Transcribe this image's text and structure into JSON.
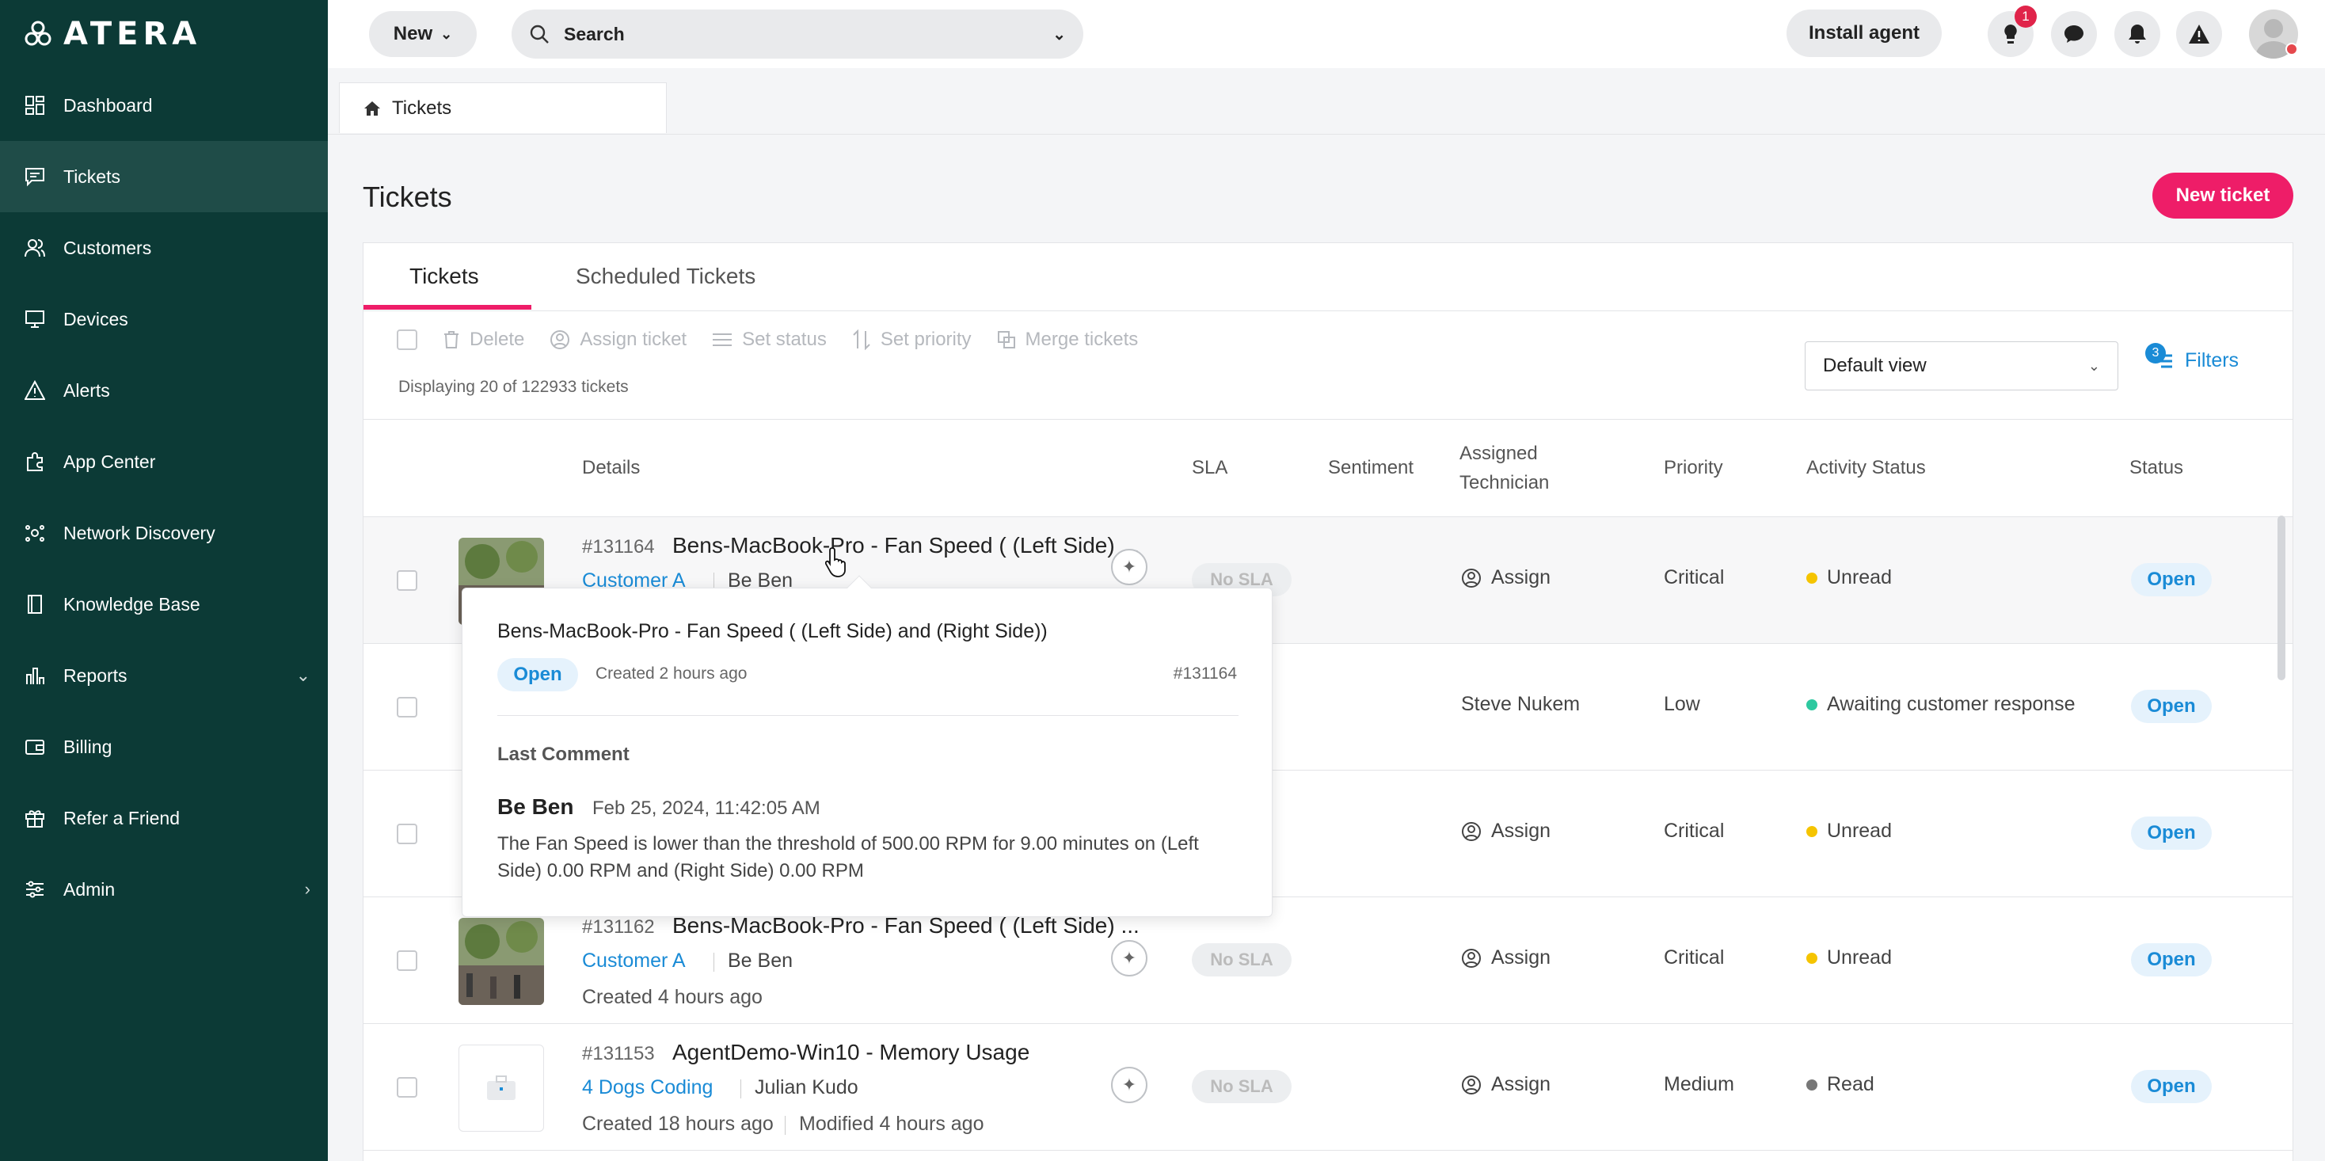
{
  "brand": {
    "name": "ATERA"
  },
  "sidebar": {
    "items": [
      {
        "label": "Dashboard",
        "icon": "dashboard-icon"
      },
      {
        "label": "Tickets",
        "icon": "tickets-icon"
      },
      {
        "label": "Customers",
        "icon": "customers-icon"
      },
      {
        "label": "Devices",
        "icon": "devices-icon"
      },
      {
        "label": "Alerts",
        "icon": "alerts-icon"
      },
      {
        "label": "App Center",
        "icon": "app-center-icon"
      },
      {
        "label": "Network Discovery",
        "icon": "network-discovery-icon"
      },
      {
        "label": "Knowledge Base",
        "icon": "knowledge-base-icon"
      },
      {
        "label": "Reports",
        "icon": "reports-icon"
      },
      {
        "label": "Billing",
        "icon": "billing-icon"
      },
      {
        "label": "Refer a Friend",
        "icon": "gift-icon"
      },
      {
        "label": "Admin",
        "icon": "admin-icon"
      }
    ],
    "active": "Tickets"
  },
  "topbar": {
    "new_label": "New",
    "search_placeholder": "Search",
    "install_label": "Install agent",
    "notification_count": "1"
  },
  "breadcrumb": {
    "label": "Tickets"
  },
  "page": {
    "title": "Tickets",
    "new_ticket_label": "New ticket"
  },
  "tabs": [
    {
      "label": "Tickets"
    },
    {
      "label": "Scheduled Tickets"
    }
  ],
  "toolbar": {
    "delete": "Delete",
    "assign": "Assign ticket",
    "set_status": "Set status",
    "set_priority": "Set priority",
    "merge": "Merge tickets",
    "displaying": "Displaying 20 of 122933 tickets",
    "view": "Default view",
    "filters": "Filters",
    "filter_count": "3"
  },
  "columns": {
    "details": "Details",
    "sla": "SLA",
    "sentiment": "Sentiment",
    "tech_line1": "Assigned",
    "tech_line2": "Technician",
    "priority": "Priority",
    "activity": "Activity Status",
    "status": "Status"
  },
  "rows": [
    {
      "id": "#131164",
      "title": "Bens-MacBook-Pro - Fan Speed ( (Left Side) ...",
      "customer": "Customer A",
      "user": "Be Ben",
      "meta": "",
      "sla": "No SLA",
      "tech": "Assign",
      "priority": "Critical",
      "activity": "Unread",
      "activity_color": "#f5c400",
      "status": "Open"
    },
    {
      "id": "",
      "title": "",
      "customer": "",
      "user": "",
      "meta": "",
      "sla": "",
      "tech": "Steve Nukem",
      "priority": "Low",
      "activity": "Awaiting customer response",
      "activity_color": "#2ec9a0",
      "status": "Open"
    },
    {
      "id": "",
      "title": "",
      "customer": "",
      "user": "",
      "meta": "",
      "sla": "",
      "tech": "Assign",
      "priority": "Critical",
      "activity": "Unread",
      "activity_color": "#f5c400",
      "status": "Open"
    },
    {
      "id": "#131162",
      "title": "Bens-MacBook-Pro - Fan Speed ( (Left Side) ...",
      "customer": "Customer A",
      "user": "Be Ben",
      "meta": "Created 4 hours ago",
      "sla": "No SLA",
      "tech": "Assign",
      "priority": "Critical",
      "activity": "Unread",
      "activity_color": "#f5c400",
      "status": "Open"
    },
    {
      "id": "#131153",
      "title": "AgentDemo-Win10 - Memory Usage",
      "customer": "4 Dogs Coding",
      "user": "Julian Kudo",
      "meta": "Created 18 hours ago",
      "meta2": "Modified 4 hours ago",
      "sla": "No SLA",
      "tech": "Assign",
      "priority": "Medium",
      "activity": "Read",
      "activity_color": "#777777",
      "status": "Open"
    }
  ],
  "popover": {
    "title": "Bens-MacBook-Pro - Fan Speed ( (Left Side) and (Right Side))",
    "status": "Open",
    "created": "Created 2 hours ago",
    "number": "#131164",
    "last_comment_label": "Last Comment",
    "author": "Be Ben",
    "date": "Feb 25, 2024, 11:42:05 AM",
    "body": "The Fan Speed is lower than the threshold of 500.00 RPM for 9.00 minutes on (Left Side) 0.00 RPM and (Right Side) 0.00 RPM"
  },
  "colors": {
    "sidebar": "#0c3a36",
    "accent": "#ee1d68",
    "link": "#1a8bd6"
  }
}
